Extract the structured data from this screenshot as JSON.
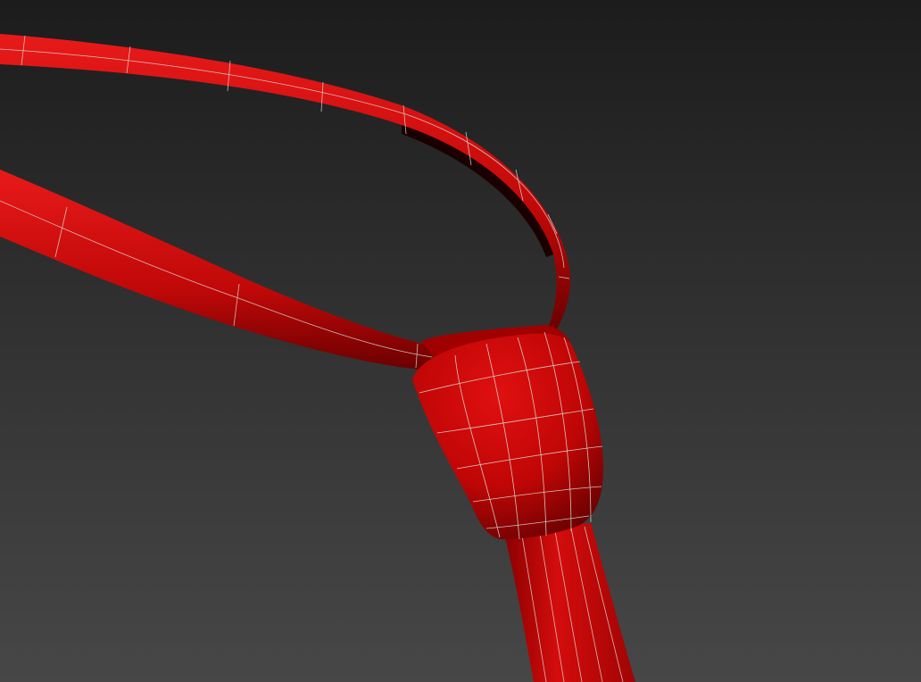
{
  "viewport": {
    "background_top": "#1c1c1c",
    "background_bottom": "#474747",
    "object": {
      "color": "#cc0a0a",
      "shadow_color": "#5a0000",
      "highlight_color": "#e81a1a",
      "wire_color": "#d8e8e0",
      "parts": [
        "neck-loop-strap",
        "lower-strap",
        "knot",
        "blade"
      ]
    }
  }
}
